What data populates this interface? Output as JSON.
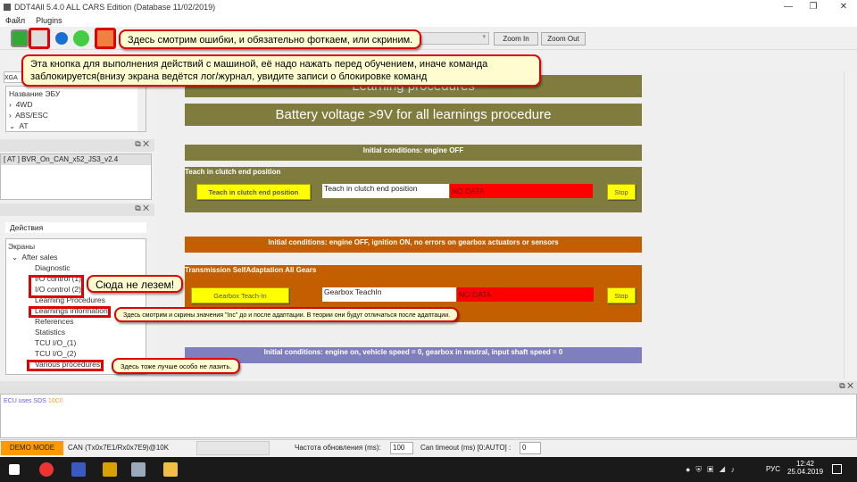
{
  "window": {
    "title": "DDT4All 5.4.0 ALL CARS Edition (Database 11/02/2019)",
    "controls": [
      "—",
      "❐",
      "✕"
    ]
  },
  "menu": [
    "Файл",
    "Plugins"
  ],
  "toolbar": {
    "zoom_in": "Zoom In",
    "zoom_out": "Zoom Out",
    "icons": [
      "ecu-monitor-icon",
      "diagnostic-brain-icon",
      "refresh-blue-icon",
      "refresh-green-icon",
      "health-heart-icon"
    ]
  },
  "callouts": {
    "errors": "Здесь смотрим ошибки, и обязательно фоткаем, или скриним.",
    "button_line1": "Эта кнопка для выполнения действий с машиной, её надо нажать перед обучением, иначе команда",
    "button_line2": "заблокируется(внизу экрана ведётся лог/журнал, увидите записи о блокировке команд",
    "no_touch": "Сюда не лезем!",
    "inc": "Здесь смотрим и скрины значения \"Inc\" до и после адаптации. В теории они будут отличаться после адаптации.",
    "various": "Здесь тоже лучше особо не лазить."
  },
  "sidebar": {
    "xga": "XGA",
    "ecu_tree": {
      "header": "Название ЭБУ",
      "items": [
        "4WD",
        "ABS/ESC",
        "AT"
      ]
    },
    "ecu_list": [
      "[ AT ] BVR_On_CAN_x52_JS3_v2.4"
    ],
    "actions_label": "Действия",
    "screens": {
      "root": "Экраны",
      "group": "After sales",
      "items": [
        "Diagnostic",
        "I/O control (1)",
        "I/O control (2)",
        "Learning Procedures",
        "Learnings information",
        "References",
        "Statistics",
        "TCU I/O_(1)",
        "TCU I/O_(2)",
        "Various procedures"
      ]
    }
  },
  "main": {
    "title": "Learning procedures",
    "battery": "Battery voltage >9V for all learnings procedure",
    "cond1": "Initial conditions: engine OFF",
    "proc1": {
      "title": "Teach in clutch end position",
      "button": "Teach in clutch end position",
      "field": "Teach in clutch end position",
      "status": "NO DATA",
      "stop": "Stop"
    },
    "cond2": "Initial conditions: engine OFF, ignition ON, no errors on gearbox actuators or sensors",
    "proc2": {
      "title": "Transmission  SelfAdaptation All Gears",
      "button": "Gearbox Teach-In",
      "field": "Gearbox TeachIn",
      "status": "NO DATA",
      "stop": "Stop"
    },
    "cond3": "Initial conditions: engine on, vehicle speed = 0, gearbox in neutral, input shaft speed = 0",
    "colors": {
      "olive": "#7f7c3e",
      "orange": "#c45f00",
      "purple": "#7f7fbf",
      "yellow": "#ffff00",
      "red": "#ff0000"
    }
  },
  "log": {
    "text": "ECU uses SDS",
    "code": "10C0"
  },
  "status": {
    "mode": "DEMO MODE",
    "can": "CAN (Tx0x7E1/Rx0x7E9)@10K",
    "refresh_label": "Частота обновления (ms):",
    "refresh_value": "100",
    "timeout_label": "Can timeout (ms) [0:AUTO] :",
    "timeout_value": "0"
  },
  "taskbar": {
    "lang": "РУС",
    "time": "12:42",
    "date": "25.04.2019"
  }
}
